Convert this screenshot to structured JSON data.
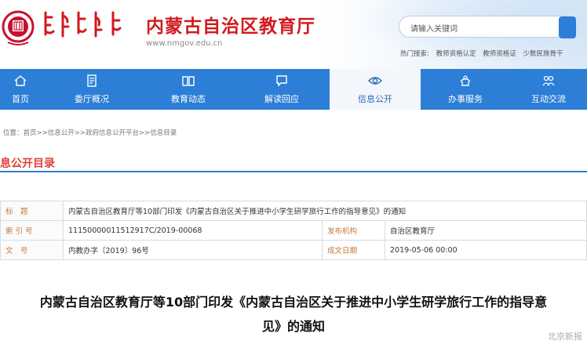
{
  "header": {
    "site_title": "内蒙古自治区教育厅",
    "site_url": "www.nmgov.edu.cn",
    "search_placeholder": "请输入关键词",
    "hot_label": "热门搜索:",
    "hot_items": [
      "教师资格认定",
      "教师资格证",
      "少数民族骨干"
    ]
  },
  "nav": {
    "items": [
      {
        "label": "首页",
        "icon": "home-icon"
      },
      {
        "label": "委厅概况",
        "icon": "document-icon"
      },
      {
        "label": "教育动态",
        "icon": "book-icon"
      },
      {
        "label": "解读回应",
        "icon": "chat-icon"
      },
      {
        "label": "信息公开",
        "icon": "eye-icon"
      },
      {
        "label": "办事服务",
        "icon": "service-icon"
      },
      {
        "label": "互动交流",
        "icon": "people-icon"
      }
    ],
    "active_index": 4
  },
  "breadcrumb": "位置：首页>>信息公开>>政府信息公开平台>>信息目录",
  "section_title": "息公开目录",
  "meta": {
    "title_key": "标　题",
    "title_value": "内蒙古自治区教育厅等10部门印发《内蒙古自治区关于推进中小学生研学旅行工作的指导意见》的通知",
    "index_key": "索 引 号",
    "index_value": "11150000011512917C/2019-00068",
    "org_key": "发布机构",
    "org_value": "自治区教育厅",
    "doc_key": "文　号",
    "doc_value": "内教办字〔2019〕96号",
    "date_key": "成文日期",
    "date_value": "2019-05-06 00:00"
  },
  "article_title_line1": "内蒙古自治区教育厅等10部门印发《内蒙古自治区关于推进中小学生研学旅行工作的指导意",
  "article_title_line2": "见》的通知",
  "watermark": "北京新报",
  "colors": {
    "nav_blue": "#2c7ed6",
    "title_red": "#d11a1f",
    "heading_red": "#e0403a"
  }
}
